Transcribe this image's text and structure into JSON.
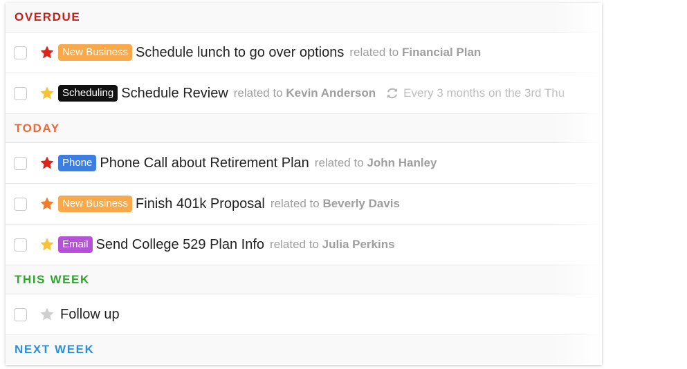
{
  "colors": {
    "overdue": "#c0221c",
    "today": "#e8693a",
    "this_week": "#29a829",
    "next_week": "#2e8fd8",
    "star_red": "#d9261c",
    "star_orange": "#f07b2a",
    "star_yellow": "#f7c235",
    "star_gray": "#cfcfcf",
    "tag_new_business": "#f9a94a",
    "tag_scheduling": "#111111",
    "tag_phone": "#3c7fe0",
    "tag_email": "#b552d8"
  },
  "sections": {
    "overdue": "OVERDUE",
    "today": "TODAY",
    "this_week": "THIS WEEK",
    "next_week": "NEXT WEEK"
  },
  "tasks": [
    {
      "star": "star-red-icon",
      "tag": "New Business",
      "title": "Schedule lunch to go over options",
      "related_prefix": "related to",
      "related_name": "Financial Plan"
    },
    {
      "star": "star-yellow-icon",
      "tag": "Scheduling",
      "title": "Schedule Review",
      "related_prefix": "related to",
      "related_name": "Kevin Anderson",
      "recurrence_icon": "repeat-icon",
      "recurrence": "Every 3 months on the 3rd Thu"
    },
    {
      "star": "star-red-icon",
      "tag": "Phone",
      "title": "Phone Call about Retirement Plan",
      "related_prefix": "related to",
      "related_name": "John Hanley"
    },
    {
      "star": "star-orange-icon",
      "tag": "New Business",
      "title": "Finish 401k Proposal",
      "related_prefix": "related to",
      "related_name": "Beverly Davis"
    },
    {
      "star": "star-yellow-icon",
      "tag": "Email",
      "title": "Send College 529 Plan Info",
      "related_prefix": "related to",
      "related_name": "Julia Perkins"
    },
    {
      "star": "star-gray-icon",
      "title": "Follow up"
    }
  ]
}
